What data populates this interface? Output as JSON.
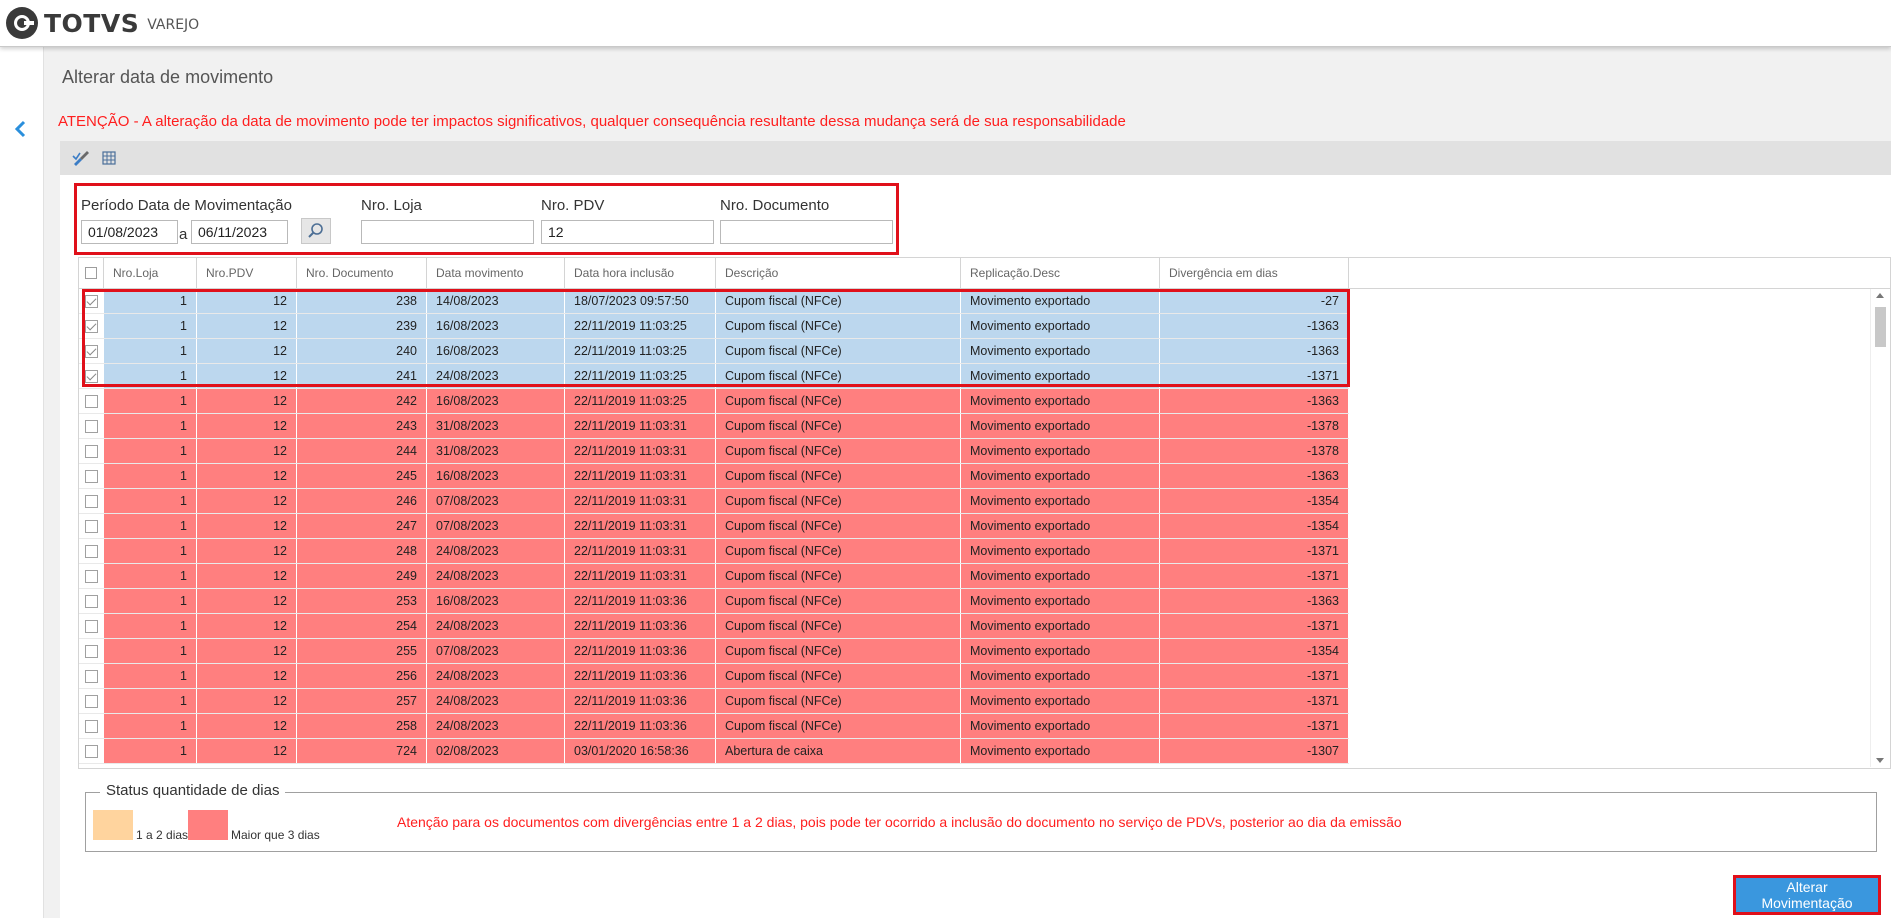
{
  "brand": {
    "name": "TOTVS",
    "sub": "VAREJO"
  },
  "page": {
    "title": "Alterar data de movimento",
    "warning": "ATENÇÃO - A alteração da data de movimento pode ter impactos significativos, qualquer consequência resultante dessa mudança será de sua responsabilidade"
  },
  "filters": {
    "period_label": "Período Data de Movimentação",
    "date_from": "01/08/2023",
    "sep": "a",
    "date_to": "06/11/2023",
    "loja_label": "Nro. Loja",
    "loja_value": "",
    "pdv_label": "Nro. PDV",
    "pdv_value": "12",
    "doc_label": "Nro. Documento",
    "doc_value": ""
  },
  "table": {
    "columns": [
      "Nro.Loja",
      "Nro.PDV",
      "Nro. Documento",
      "Data movimento",
      "Data hora inclusão",
      "Descrição",
      "Replicação.Desc",
      "Divergência em dias"
    ],
    "rows": [
      {
        "selected": true,
        "loja": "1",
        "pdv": "12",
        "doc": "238",
        "mov": "14/08/2023",
        "incl": "18/07/2023 09:57:50",
        "desc": "Cupom fiscal (NFCe)",
        "rep": "Movimento exportado",
        "div": "-27"
      },
      {
        "selected": true,
        "loja": "1",
        "pdv": "12",
        "doc": "239",
        "mov": "16/08/2023",
        "incl": "22/11/2019 11:03:25",
        "desc": "Cupom fiscal (NFCe)",
        "rep": "Movimento exportado",
        "div": "-1363"
      },
      {
        "selected": true,
        "loja": "1",
        "pdv": "12",
        "doc": "240",
        "mov": "16/08/2023",
        "incl": "22/11/2019 11:03:25",
        "desc": "Cupom fiscal (NFCe)",
        "rep": "Movimento exportado",
        "div": "-1363"
      },
      {
        "selected": true,
        "loja": "1",
        "pdv": "12",
        "doc": "241",
        "mov": "24/08/2023",
        "incl": "22/11/2019 11:03:25",
        "desc": "Cupom fiscal (NFCe)",
        "rep": "Movimento exportado",
        "div": "-1371"
      },
      {
        "selected": false,
        "loja": "1",
        "pdv": "12",
        "doc": "242",
        "mov": "16/08/2023",
        "incl": "22/11/2019 11:03:25",
        "desc": "Cupom fiscal (NFCe)",
        "rep": "Movimento exportado",
        "div": "-1363"
      },
      {
        "selected": false,
        "loja": "1",
        "pdv": "12",
        "doc": "243",
        "mov": "31/08/2023",
        "incl": "22/11/2019 11:03:31",
        "desc": "Cupom fiscal (NFCe)",
        "rep": "Movimento exportado",
        "div": "-1378"
      },
      {
        "selected": false,
        "loja": "1",
        "pdv": "12",
        "doc": "244",
        "mov": "31/08/2023",
        "incl": "22/11/2019 11:03:31",
        "desc": "Cupom fiscal (NFCe)",
        "rep": "Movimento exportado",
        "div": "-1378"
      },
      {
        "selected": false,
        "loja": "1",
        "pdv": "12",
        "doc": "245",
        "mov": "16/08/2023",
        "incl": "22/11/2019 11:03:31",
        "desc": "Cupom fiscal (NFCe)",
        "rep": "Movimento exportado",
        "div": "-1363"
      },
      {
        "selected": false,
        "loja": "1",
        "pdv": "12",
        "doc": "246",
        "mov": "07/08/2023",
        "incl": "22/11/2019 11:03:31",
        "desc": "Cupom fiscal (NFCe)",
        "rep": "Movimento exportado",
        "div": "-1354"
      },
      {
        "selected": false,
        "loja": "1",
        "pdv": "12",
        "doc": "247",
        "mov": "07/08/2023",
        "incl": "22/11/2019 11:03:31",
        "desc": "Cupom fiscal (NFCe)",
        "rep": "Movimento exportado",
        "div": "-1354"
      },
      {
        "selected": false,
        "loja": "1",
        "pdv": "12",
        "doc": "248",
        "mov": "24/08/2023",
        "incl": "22/11/2019 11:03:31",
        "desc": "Cupom fiscal (NFCe)",
        "rep": "Movimento exportado",
        "div": "-1371"
      },
      {
        "selected": false,
        "loja": "1",
        "pdv": "12",
        "doc": "249",
        "mov": "24/08/2023",
        "incl": "22/11/2019 11:03:31",
        "desc": "Cupom fiscal (NFCe)",
        "rep": "Movimento exportado",
        "div": "-1371"
      },
      {
        "selected": false,
        "loja": "1",
        "pdv": "12",
        "doc": "253",
        "mov": "16/08/2023",
        "incl": "22/11/2019 11:03:36",
        "desc": "Cupom fiscal (NFCe)",
        "rep": "Movimento exportado",
        "div": "-1363"
      },
      {
        "selected": false,
        "loja": "1",
        "pdv": "12",
        "doc": "254",
        "mov": "24/08/2023",
        "incl": "22/11/2019 11:03:36",
        "desc": "Cupom fiscal (NFCe)",
        "rep": "Movimento exportado",
        "div": "-1371"
      },
      {
        "selected": false,
        "loja": "1",
        "pdv": "12",
        "doc": "255",
        "mov": "07/08/2023",
        "incl": "22/11/2019 11:03:36",
        "desc": "Cupom fiscal (NFCe)",
        "rep": "Movimento exportado",
        "div": "-1354"
      },
      {
        "selected": false,
        "loja": "1",
        "pdv": "12",
        "doc": "256",
        "mov": "24/08/2023",
        "incl": "22/11/2019 11:03:36",
        "desc": "Cupom fiscal (NFCe)",
        "rep": "Movimento exportado",
        "div": "-1371"
      },
      {
        "selected": false,
        "loja": "1",
        "pdv": "12",
        "doc": "257",
        "mov": "24/08/2023",
        "incl": "22/11/2019 11:03:36",
        "desc": "Cupom fiscal (NFCe)",
        "rep": "Movimento exportado",
        "div": "-1371"
      },
      {
        "selected": false,
        "loja": "1",
        "pdv": "12",
        "doc": "258",
        "mov": "24/08/2023",
        "incl": "22/11/2019 11:03:36",
        "desc": "Cupom fiscal (NFCe)",
        "rep": "Movimento exportado",
        "div": "-1371"
      },
      {
        "selected": false,
        "loja": "1",
        "pdv": "12",
        "doc": "724",
        "mov": "02/08/2023",
        "incl": "03/01/2020 16:58:36",
        "desc": "Abertura de caixa",
        "rep": "Movimento exportado",
        "div": "-1307"
      }
    ]
  },
  "legend": {
    "title": "Status quantidade de dias",
    "item1_label": "1 a 2 dias",
    "item1_color": "#ffd49e",
    "item2_label": "Maior que 3 dias",
    "item2_color": "#ff7f7f",
    "note": "Atenção para os documentos com divergências entre 1 a 2 dias, pois pode ter ocorrido a inclusão do documento no serviço de PDVs, posterior ao dia da emissão"
  },
  "actions": {
    "submit_label": "Alterar Movimentação"
  },
  "colors": {
    "selected_row": "#bcd7ee",
    "divergent_row": "#ff7f7f",
    "accent": "#3a97de",
    "highlight": "#e0101a"
  },
  "icons": [
    "back-icon",
    "clear-filter-icon",
    "grid-icon",
    "search-icon"
  ]
}
